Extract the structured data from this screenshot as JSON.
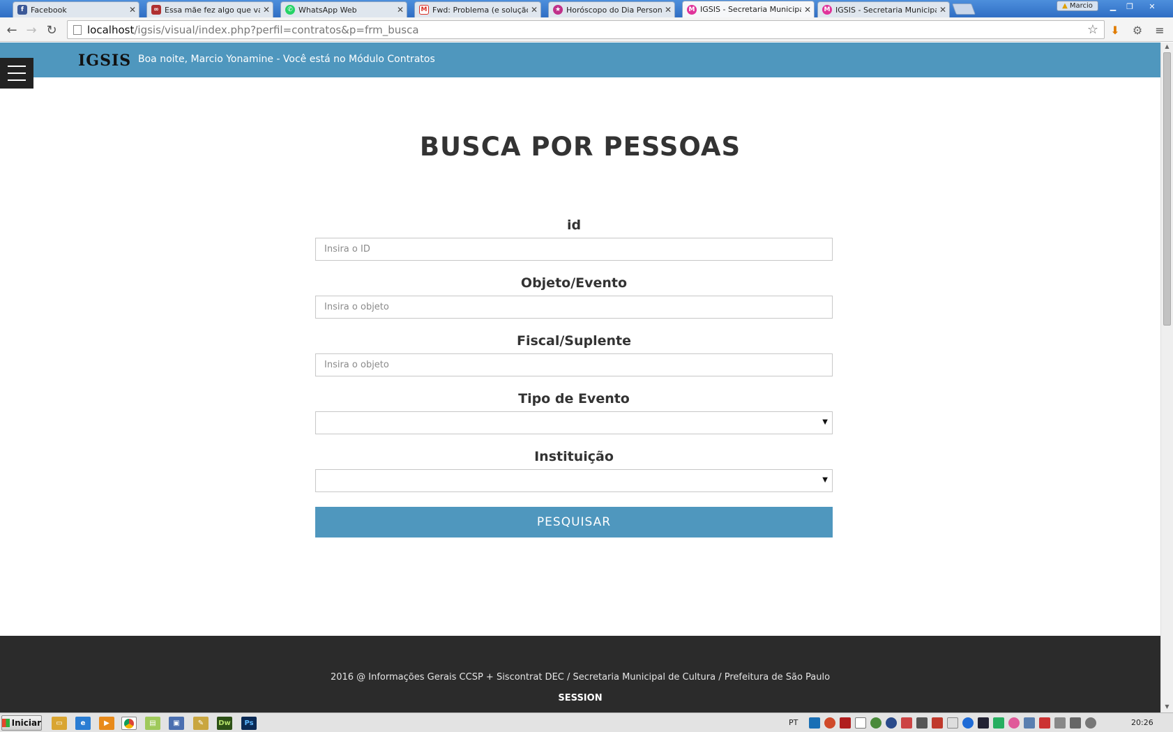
{
  "browser": {
    "tabs": [
      {
        "label": "Facebook",
        "favicon": "facebook-icon",
        "color": "#3b5998"
      },
      {
        "label": "Essa mãe fez algo que vai se",
        "favicon": "glasses-icon",
        "color": "#b03030"
      },
      {
        "label": "WhatsApp Web",
        "favicon": "whatsapp-icon",
        "color": "#25d366"
      },
      {
        "label": "Fwd: Problema (e solução) nc",
        "favicon": "gmail-icon",
        "color": "#d93025"
      },
      {
        "label": "Horóscopo do Dia Personaliza",
        "favicon": "star-icon",
        "color": "#c0308a"
      },
      {
        "label": "IGSIS - Secretaria Municipal d",
        "favicon": "igsis-icon",
        "color": "#e0339a"
      },
      {
        "label": "IGSIS - Secretaria Municipal d",
        "favicon": "igsis-icon",
        "color": "#e0339a"
      }
    ],
    "active_tab_index": 5,
    "user_label": "Marcio",
    "url_host": "localhost",
    "url_path": "/igsis/visual/index.php?perfil=contratos&p=frm_busca"
  },
  "header": {
    "brand": "IGSIS",
    "greeting": "Boa noite, Marcio Yonamine - Você está no Módulo Contratos"
  },
  "page": {
    "title": "BUSCA POR PESSOAS"
  },
  "form": {
    "id_label": "id",
    "id_placeholder": "Insira o ID",
    "objeto_label": "Objeto/Evento",
    "objeto_placeholder": "Insira o objeto",
    "fiscal_label": "Fiscal/Suplente",
    "fiscal_placeholder": "Insira o objeto",
    "tipo_label": "Tipo de Evento",
    "tipo_value": "",
    "instituicao_label": "Instituição",
    "instituicao_value": "",
    "submit_label": "PESQUISAR"
  },
  "footer": {
    "credits": "2016 @ Informações Gerais CCSP + Siscontrat DEC / Secretaria Municipal de Cultura / Prefeitura de São Paulo",
    "session": "SESSION"
  },
  "taskbar": {
    "start_label": "Iniciar",
    "language": "PT",
    "clock": "20:26"
  },
  "colors": {
    "accent": "#4f97be",
    "footer_bg": "#2b2b2b",
    "heading": "#333333"
  }
}
